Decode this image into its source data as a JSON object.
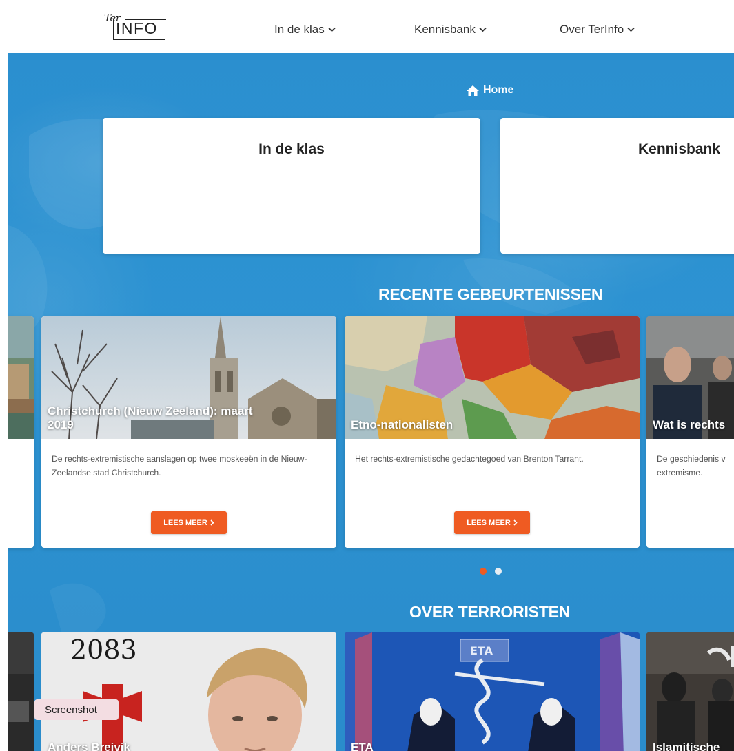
{
  "header": {
    "logo": {
      "small": "Ter",
      "main": "INFO"
    },
    "nav": [
      {
        "label": "In de klas"
      },
      {
        "label": "Kennisbank"
      },
      {
        "label": "Over TerInfo"
      }
    ]
  },
  "breadcrumb": {
    "label": "Home",
    "icon": "home-icon"
  },
  "tiles": [
    {
      "title": "In de klas"
    },
    {
      "title": "Kennisbank"
    }
  ],
  "recent": {
    "title": "RECENTE GEBEURTENISSEN",
    "cards": [
      {
        "caption": "Christchurch (Nieuw Zeeland): maart 2019",
        "description": "De rechts-extremistische aanslagen op twee moskeeën in de Nieuw-Zeelandse stad Christchurch.",
        "button": "LEES MEER"
      },
      {
        "caption": "Etno-nationalisten",
        "description": "Het rechts-extremistische gedachtegoed van Brenton Tarrant.",
        "button": "LEES MEER"
      },
      {
        "caption": "Wat is rechts",
        "description": "De geschiedenis v extremisme."
      }
    ],
    "pagination": {
      "total": 2,
      "active": 1
    }
  },
  "terrorists": {
    "title": "OVER TERRORISTEN",
    "cards": [
      {
        "caption": "Anders Breivik",
        "image_text": "2083"
      },
      {
        "caption": "ETA",
        "image_text": "ETA"
      },
      {
        "caption": "Islamitische"
      }
    ]
  },
  "overlay": {
    "tooltip": "Screenshot"
  },
  "colors": {
    "hero_blue": "#2b8fcf",
    "button_orange": "#ef5b22",
    "dot_active": "#ef5b22",
    "dot_inactive": "#e8eef3"
  }
}
